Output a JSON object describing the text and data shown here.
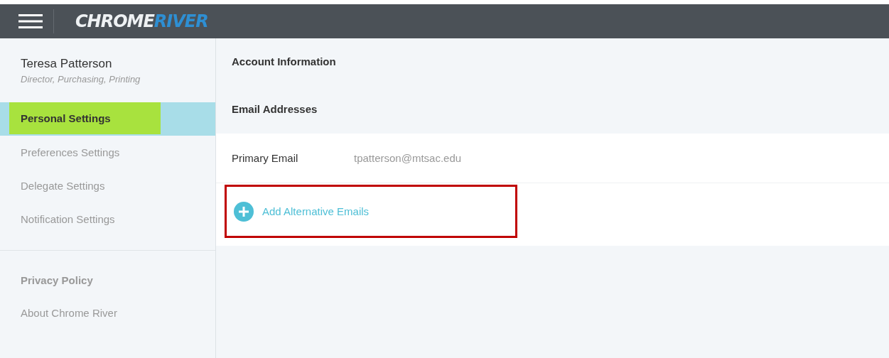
{
  "header": {
    "logo": [
      "CHROME",
      "RIVER"
    ]
  },
  "user": {
    "name": "Teresa Patterson",
    "title": "Director, Purchasing, Printing"
  },
  "nav": [
    {
      "label": "Personal Settings",
      "selected": true,
      "highlighted": true
    },
    {
      "label": "Preferences Settings",
      "selected": false,
      "highlighted": false
    },
    {
      "label": "Delegate Settings",
      "selected": false,
      "highlighted": false
    },
    {
      "label": "Notification Settings",
      "selected": false,
      "highlighted": false
    }
  ],
  "footer_links": [
    {
      "label": "Privacy Policy",
      "kind": "bold"
    },
    {
      "label": "About Chrome River",
      "kind": "plain"
    }
  ],
  "main": {
    "heading": "Account Information",
    "section": "Email Addresses",
    "primary": {
      "label": "Primary Email",
      "value": "tpatterson@mtsac.edu"
    },
    "add_link": {
      "label": "Add Alternative Emails",
      "annotated": true
    }
  }
}
